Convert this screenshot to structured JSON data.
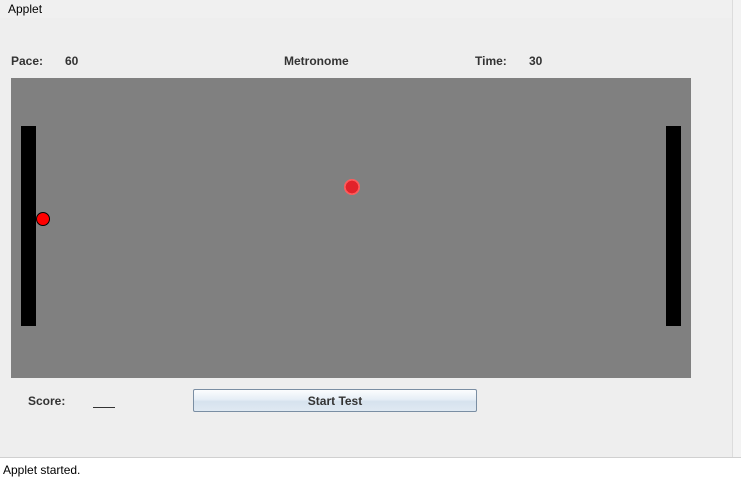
{
  "window": {
    "menu_label": "Applet"
  },
  "header": {
    "pace_label": "Pace:",
    "pace_value": "60",
    "title": "Metronome",
    "time_label": "Time:",
    "time_value": "30"
  },
  "game": {
    "left_paddle": "paddle",
    "right_paddle": "paddle",
    "ball_color": "#ff0000",
    "field_color": "#808080"
  },
  "footer": {
    "score_label": "Score:",
    "score_value": "",
    "start_button_label": "Start Test"
  },
  "status": {
    "text": "Applet started."
  }
}
